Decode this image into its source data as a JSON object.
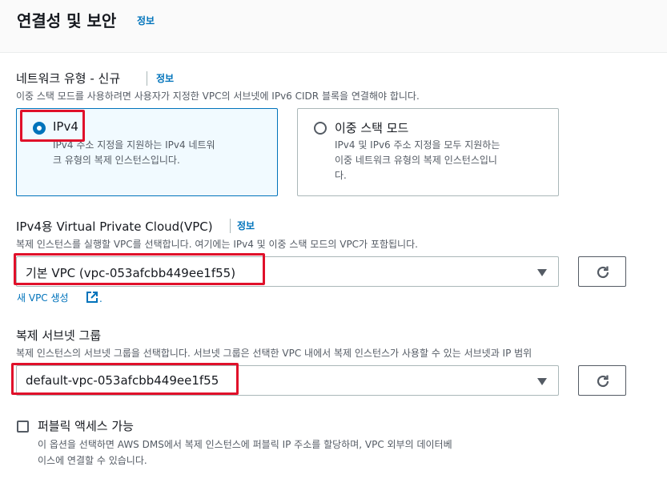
{
  "section": {
    "title": "연결성 및 보안",
    "info_label": "정보"
  },
  "network_type": {
    "label": "네트워크 유형 - 신규",
    "info_label": "정보",
    "description": "이중 스택 모드를 사용하려면 사용자가 지정한 VPC의 서브넷에 IPv6 CIDR 블록을 연결해야 합니다.",
    "options": [
      {
        "title": "IPv4",
        "description_line1": "IPv4 주소 지정을 지원하는 IPv4 네트워",
        "description_line2": "크 유형의 복제 인스턴스입니다.",
        "selected": true
      },
      {
        "title": "이중 스택 모드",
        "description_line1": "IPv4 및 IPv6 주소 지정을 모두 지원하는",
        "description_line2": "이중 네트워크 유형의 복제 인스턴스입니",
        "description_line3": "다.",
        "selected": false
      }
    ]
  },
  "vpc": {
    "label": "IPv4용 Virtual Private Cloud(VPC)",
    "info_label": "정보",
    "description": "복제 인스턴스를 실행할 VPC를 선택합니다. 여기에는 IPv4 및 이중 스택 모드의 VPC가 포함됩니다.",
    "selected_value": "기본 VPC (vpc-053afcbb449ee1f55)",
    "create_link": "새 VPC 생성",
    "create_link_suffix": "."
  },
  "subnet_group": {
    "label": "복제 서브넷 그룹",
    "description": "복제 인스턴스의 서브넷 그룹을 선택합니다. 서브넷 그룹은 선택한 VPC 내에서 복제 인스턴스가 사용할 수 있는 서브넷과 IP 범위",
    "selected_value": "default-vpc-053afcbb449ee1f55"
  },
  "public_access": {
    "label": "퍼블릭 액세스 가능",
    "checked": false,
    "description_line1": "이 옵션을 선택하면 AWS DMS에서 복제 인스턴스에 퍼블릭 IP 주소를 할당하며, VPC 외부의 데이터베",
    "description_line2": "이스에 연결할 수 있습니다."
  },
  "icons": {
    "refresh": "refresh-icon",
    "caret": "caret-down-icon",
    "external": "external-link-icon"
  },
  "colors": {
    "accent": "#0073bb",
    "highlight": "#e0102a",
    "selected_tile_bg": "#f1faff"
  }
}
